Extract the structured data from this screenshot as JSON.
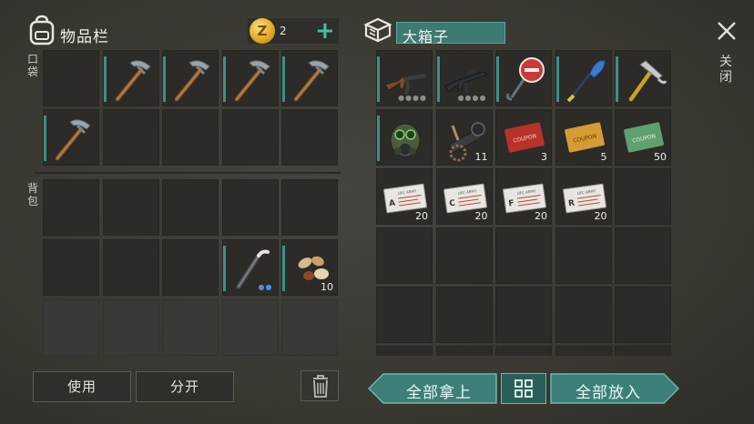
{
  "inventory": {
    "title": "物品栏",
    "pocket_label": "口袋",
    "backpack_label": "背包",
    "coins": "2",
    "coin_symbol": "Z",
    "add_symbol": "+",
    "pocket_slots": [
      {
        "item": "empty"
      },
      {
        "item": "pickaxe"
      },
      {
        "item": "pickaxe"
      },
      {
        "item": "pickaxe"
      },
      {
        "item": "pickaxe"
      },
      {
        "item": "pickaxe"
      },
      {
        "item": "empty"
      },
      {
        "item": "empty"
      },
      {
        "item": "empty"
      },
      {
        "item": "empty"
      }
    ],
    "backpack_slots": [
      {
        "item": "empty"
      },
      {
        "item": "empty"
      },
      {
        "item": "empty"
      },
      {
        "item": "empty"
      },
      {
        "item": "empty"
      },
      {
        "item": "empty"
      },
      {
        "item": "empty"
      },
      {
        "item": "empty"
      },
      {
        "item": "crowbar"
      },
      {
        "item": "seeds",
        "count": "10"
      },
      {
        "item": "locked"
      },
      {
        "item": "locked"
      },
      {
        "item": "locked"
      },
      {
        "item": "locked"
      },
      {
        "item": "locked"
      }
    ],
    "use_label": "使用",
    "split_label": "分开"
  },
  "container": {
    "title": "大箱子",
    "slots": [
      {
        "item": "ak-rifle"
      },
      {
        "item": "m16-rifle"
      },
      {
        "item": "stop-sign"
      },
      {
        "item": "paddle"
      },
      {
        "item": "hammer"
      },
      {
        "item": "gas-mask"
      },
      {
        "item": "scope-parts",
        "count": "11"
      },
      {
        "item": "red-coupon",
        "count": "3"
      },
      {
        "item": "orange-coupon",
        "count": "5"
      },
      {
        "item": "green-coupon",
        "count": "50"
      },
      {
        "item": "army-ticket-a",
        "count": "20",
        "letter": "A"
      },
      {
        "item": "army-ticket-c",
        "count": "20",
        "letter": "C"
      },
      {
        "item": "army-ticket-f",
        "count": "20",
        "letter": "F"
      },
      {
        "item": "army-ticket-r",
        "count": "20",
        "letter": "R"
      },
      {
        "item": "empty"
      }
    ],
    "take_all_label": "全部拿上",
    "put_all_label": "全部放入",
    "coupon_text": "COUPON",
    "ticket_text": "UFC ARMY"
  },
  "close_label": "关闭",
  "colors": {
    "accent": "#3e8f86",
    "teal_button": "#3d7f78",
    "slot": "#2c2b28",
    "background": "#3c3b37"
  }
}
